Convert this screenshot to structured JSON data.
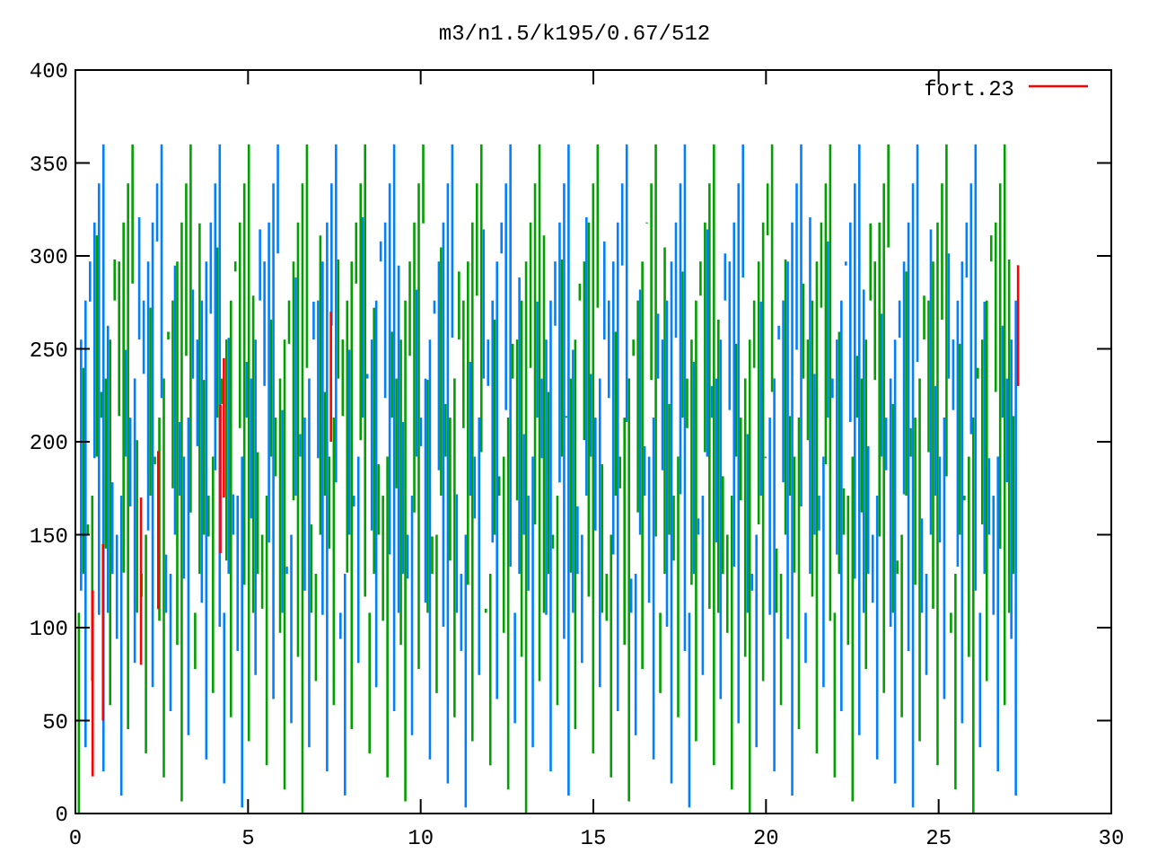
{
  "plot": {
    "title": "m3/n1.5/k195/0.67/512",
    "legend": {
      "label": "fort.23"
    },
    "y_axis_labels": [
      "400",
      "350",
      "300",
      "250",
      "200",
      "150",
      "100",
      "50",
      "0"
    ],
    "x_axis_labels": [
      "0",
      "5",
      "10",
      "15",
      "20",
      "25",
      "30"
    ]
  }
}
